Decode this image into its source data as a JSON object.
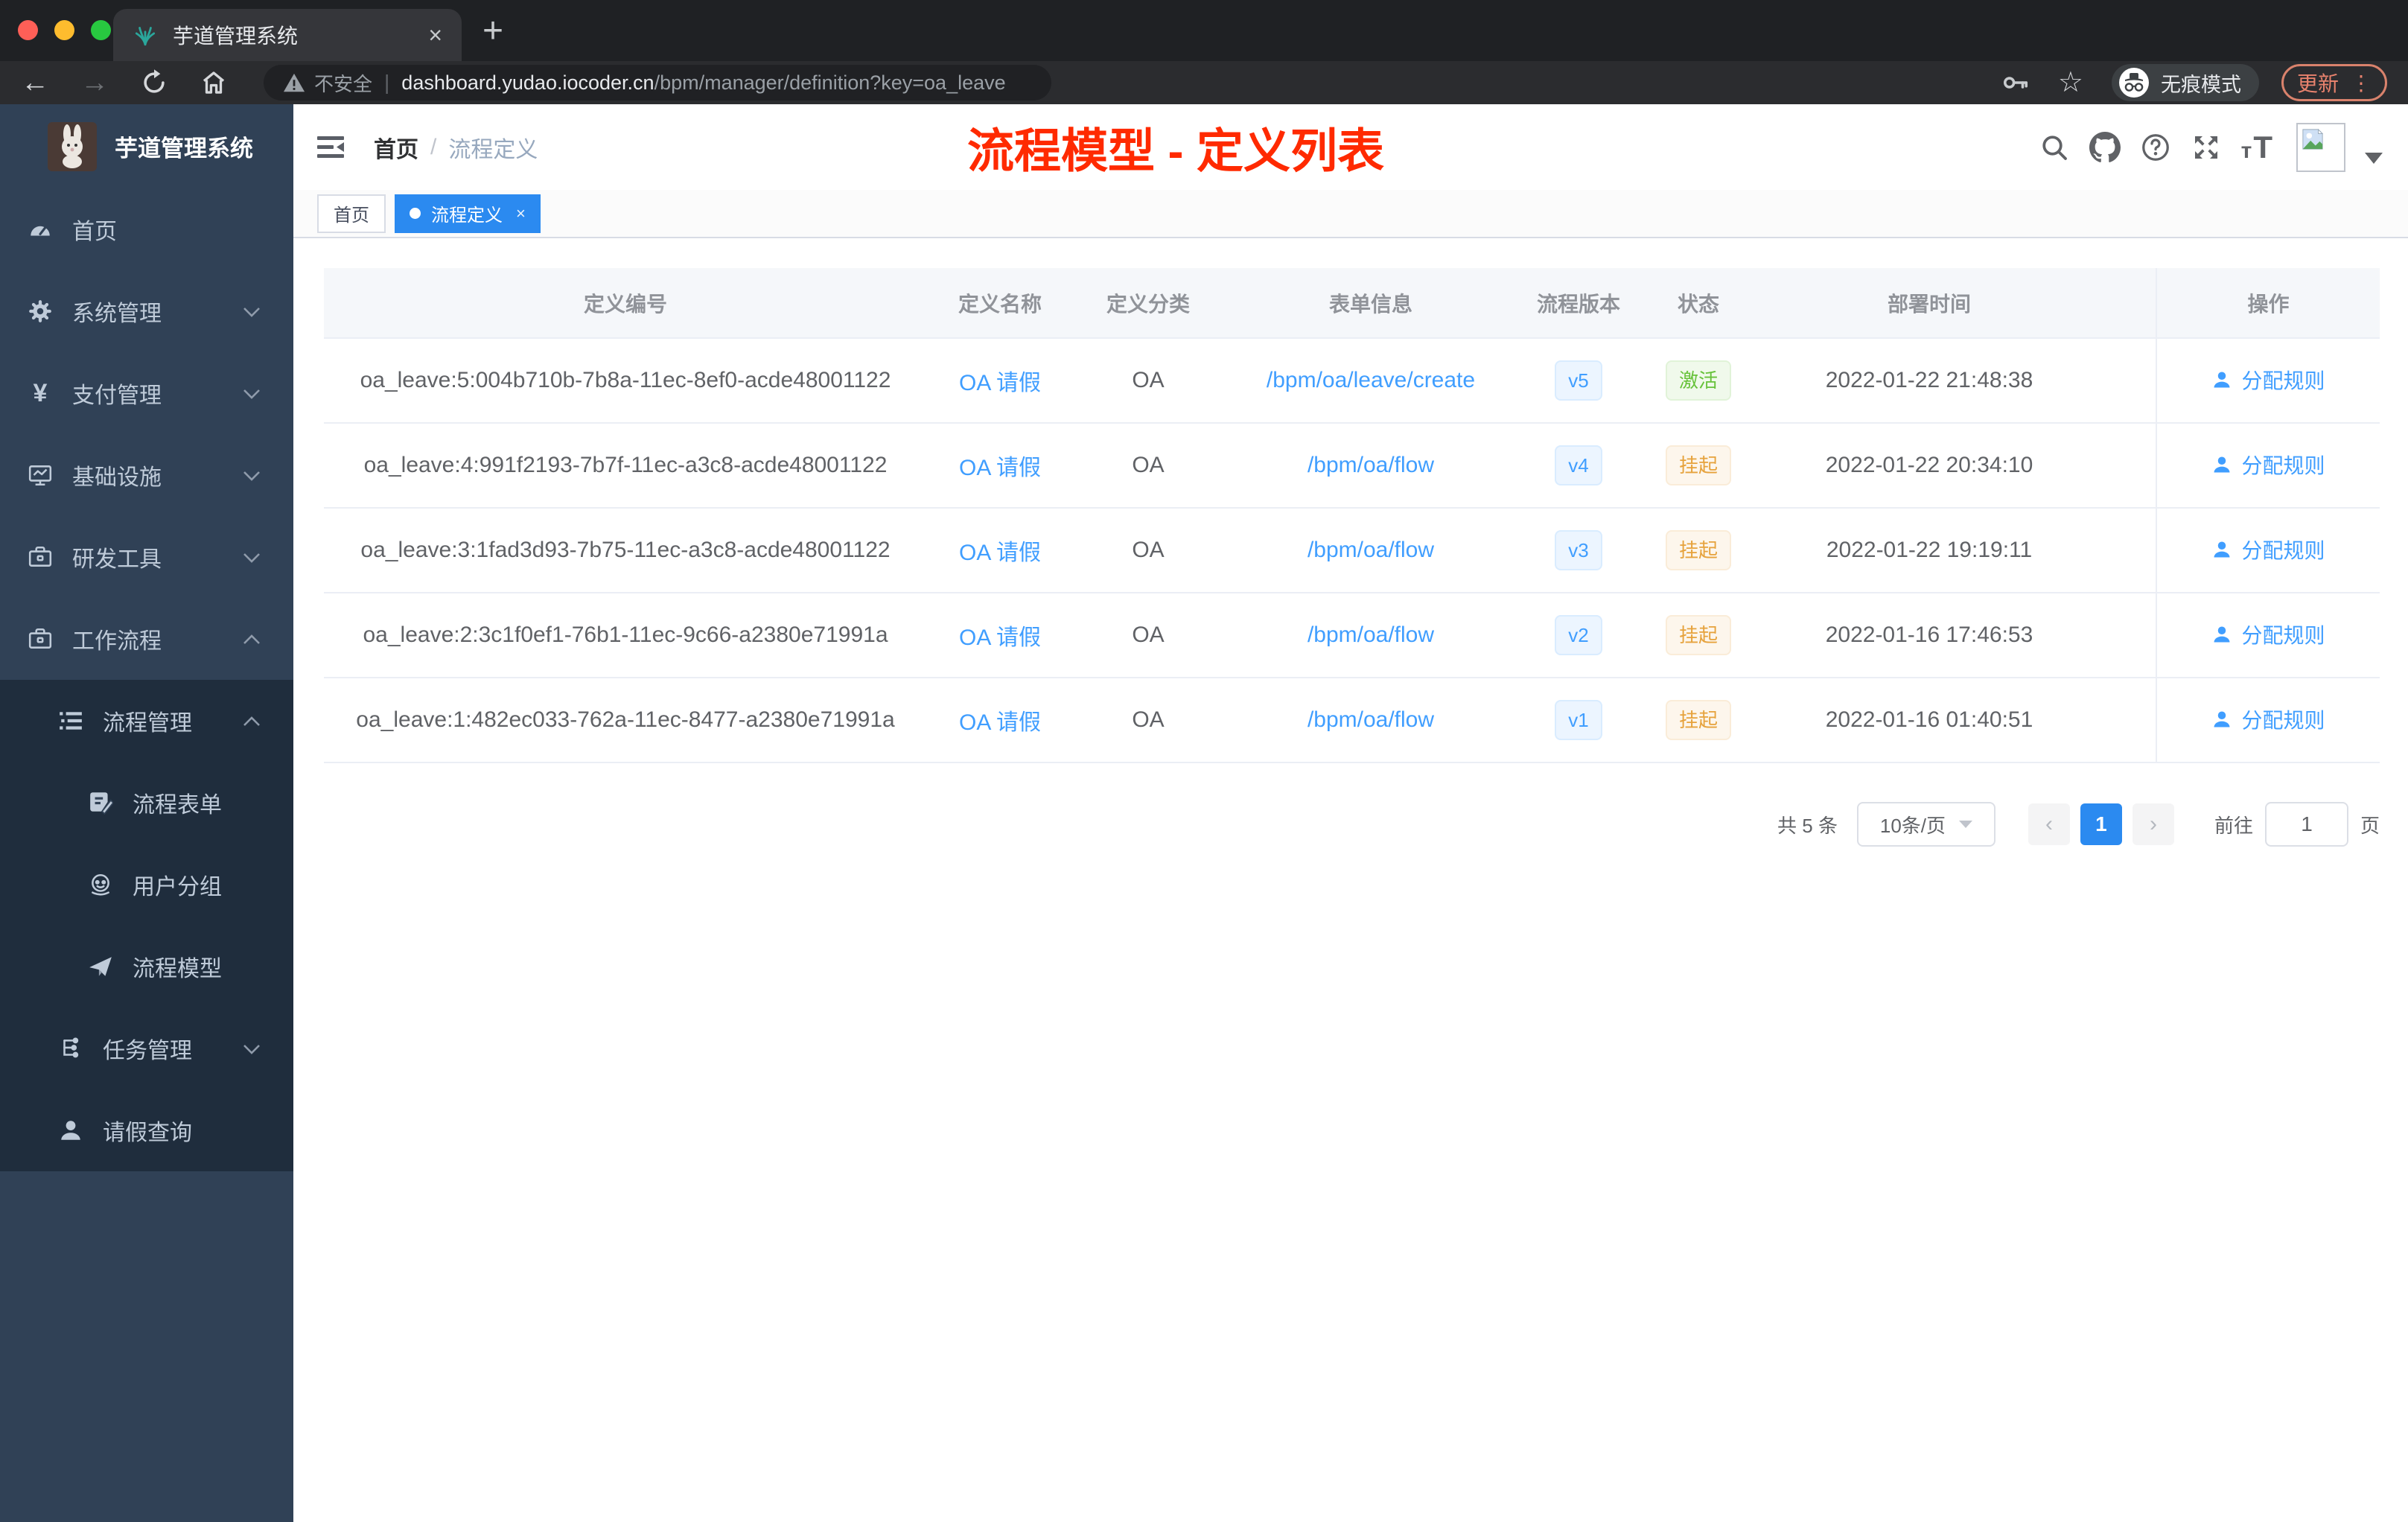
{
  "browser": {
    "tab_title": "芋道管理系统",
    "tab_close": "×",
    "new_tab": "+",
    "back": "←",
    "forward": "→",
    "security_label": "不安全",
    "url_separator": "|",
    "url_host": "dashboard.yudao.iocoder.cn",
    "url_path": "/bpm/manager/definition?key=oa_leave",
    "incognito_label": "无痕模式",
    "update_label": "更新",
    "menu_dots": "⋮",
    "star": "☆"
  },
  "sidebar": {
    "title": "芋道管理系统",
    "items": [
      {
        "label": "首页",
        "icon": "dashboard-icon"
      },
      {
        "label": "系统管理",
        "icon": "gear-icon"
      },
      {
        "label": "支付管理",
        "icon": "yen-icon",
        "yen_glyph": "¥"
      },
      {
        "label": "基础设施",
        "icon": "monitor-chart-icon"
      },
      {
        "label": "研发工具",
        "icon": "toolbox-icon"
      },
      {
        "label": "工作流程",
        "icon": "briefcase-icon"
      },
      {
        "label": "流程管理",
        "icon": "tree-list-icon"
      },
      {
        "label": "流程表单",
        "icon": "form-edit-icon"
      },
      {
        "label": "用户分组",
        "icon": "robot-icon"
      },
      {
        "label": "流程模型",
        "icon": "paper-plane-icon"
      },
      {
        "label": "任务管理",
        "icon": "org-tree-icon"
      },
      {
        "label": "请假查询",
        "icon": "user-icon"
      }
    ]
  },
  "header": {
    "breadcrumb_root": "首页",
    "breadcrumb_separator": "/",
    "breadcrumb_current": "流程定义",
    "annotation": "流程模型 - 定义列表"
  },
  "tags": {
    "home": "首页",
    "active": "流程定义",
    "active_close": "×"
  },
  "table": {
    "columns": [
      "定义编号",
      "定义名称",
      "定义分类",
      "表单信息",
      "流程版本",
      "状态",
      "部署时间",
      "操作"
    ],
    "rows": [
      {
        "id": "oa_leave:5:004b710b-7b8a-11ec-8ef0-acde48001122",
        "name": "OA 请假",
        "category": "OA",
        "form": "/bpm/oa/leave/create",
        "version": "v5",
        "status": "激活",
        "status_type": "success",
        "deployed_at": "2022-01-22 21:48:38",
        "action": "分配规则"
      },
      {
        "id": "oa_leave:4:991f2193-7b7f-11ec-a3c8-acde48001122",
        "name": "OA 请假",
        "category": "OA",
        "form": "/bpm/oa/flow",
        "version": "v4",
        "status": "挂起",
        "status_type": "warning",
        "deployed_at": "2022-01-22 20:34:10",
        "action": "分配规则"
      },
      {
        "id": "oa_leave:3:1fad3d93-7b75-11ec-a3c8-acde48001122",
        "name": "OA 请假",
        "category": "OA",
        "form": "/bpm/oa/flow",
        "version": "v3",
        "status": "挂起",
        "status_type": "warning",
        "deployed_at": "2022-01-22 19:19:11",
        "action": "分配规则"
      },
      {
        "id": "oa_leave:2:3c1f0ef1-76b1-11ec-9c66-a2380e71991a",
        "name": "OA 请假",
        "category": "OA",
        "form": "/bpm/oa/flow",
        "version": "v2",
        "status": "挂起",
        "status_type": "warning",
        "deployed_at": "2022-01-16 17:46:53",
        "action": "分配规则"
      },
      {
        "id": "oa_leave:1:482ec033-762a-11ec-8477-a2380e71991a",
        "name": "OA 请假",
        "category": "OA",
        "form": "/bpm/oa/flow",
        "version": "v1",
        "status": "挂起",
        "status_type": "warning",
        "deployed_at": "2022-01-16 01:40:51",
        "action": "分配规则"
      }
    ]
  },
  "pagination": {
    "total": "共 5 条",
    "page_size": "10条/页",
    "prev": "‹",
    "current": "1",
    "next": "›",
    "goto_label": "前往",
    "goto_value": "1",
    "page_label": "页"
  },
  "colors": {
    "accent_blue": "#2b8af0",
    "link_blue": "#409eff",
    "success_green": "#67c23a",
    "warning_orange": "#e6a23c",
    "annotation_red": "#ff2a00",
    "sidebar_bg": "#304156",
    "submenu_bg": "#1f2d3d",
    "table_header_bg": "#f5f7fa"
  }
}
